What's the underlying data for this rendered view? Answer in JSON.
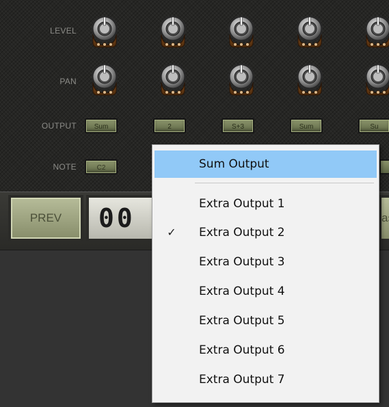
{
  "rows": {
    "level_label": "LEVEL",
    "pan_label": "PAN",
    "output_label": "OUTPUT",
    "note_label": "NOTE"
  },
  "outputs": [
    "Sum",
    "2",
    "S+3",
    "Sum",
    "Su"
  ],
  "notes": [
    "C2"
  ],
  "transport": {
    "prev_label": "PREV",
    "counter": "00",
    "right_partial": "as"
  },
  "menu": {
    "items": [
      {
        "label": "Sum Output",
        "checked": false,
        "highlighted": true
      },
      {
        "label": "Extra Output 1",
        "checked": false,
        "highlighted": false
      },
      {
        "label": "Extra Output 2",
        "checked": true,
        "highlighted": false
      },
      {
        "label": "Extra Output 3",
        "checked": false,
        "highlighted": false
      },
      {
        "label": "Extra Output 4",
        "checked": false,
        "highlighted": false
      },
      {
        "label": "Extra Output 5",
        "checked": false,
        "highlighted": false
      },
      {
        "label": "Extra Output 6",
        "checked": false,
        "highlighted": false
      },
      {
        "label": "Extra Output 7",
        "checked": false,
        "highlighted": false
      }
    ],
    "check_glyph": "✓"
  },
  "colors": {
    "highlight": "#91c9f7",
    "knob_brown": "#6b3d14",
    "button_green": "#7c8560"
  }
}
